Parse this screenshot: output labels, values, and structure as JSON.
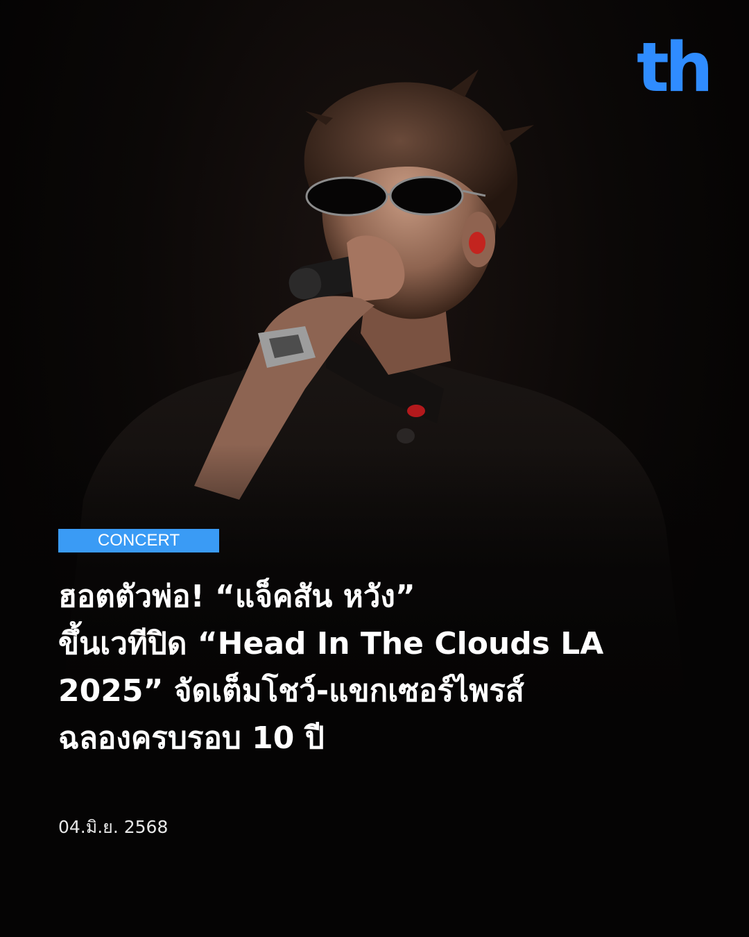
{
  "brand": {
    "logo_text": "th",
    "logo_color": "#2f8cff"
  },
  "photo": {
    "subject": "performer-with-sunglasses-singing-into-microphone"
  },
  "category": {
    "label": "CONCERT",
    "color": "#3a9bf5"
  },
  "headline": {
    "lines": [
      "ฮอตตัวพ่อ! “แจ็คสัน หวัง”",
      "ขึ้นเวทีปิด “Head In The Clouds LA",
      "2025” จัดเต็มโชว์-แขกเซอร์ไพรส์",
      "ฉลองครบรอบ 10 ปี"
    ]
  },
  "date": "04.มิ.ย. 2568"
}
